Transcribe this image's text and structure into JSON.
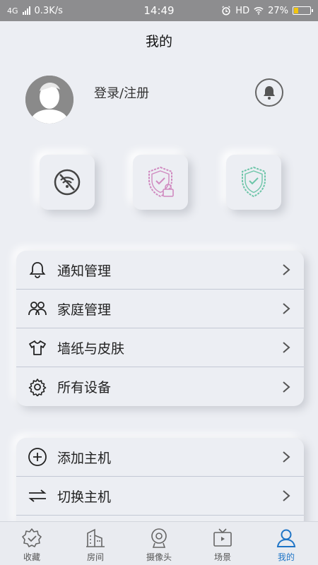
{
  "status_bar": {
    "network": "4G",
    "speed": "0.3K/s",
    "time": "14:49",
    "hd": "HD",
    "battery_percent": "27%",
    "battery_level": 0.27
  },
  "header": {
    "title": "我的"
  },
  "profile": {
    "login_label": "登录/注册"
  },
  "quick_actions": [
    {
      "icon": "wifi-off-icon"
    },
    {
      "icon": "shield-lock-icon",
      "color": "#d08ac0"
    },
    {
      "icon": "shield-check-icon",
      "color": "#6cc5a8"
    }
  ],
  "menu_primary": [
    {
      "label": "通知管理",
      "icon": "bell-outline-icon"
    },
    {
      "label": "家庭管理",
      "icon": "family-icon"
    },
    {
      "label": "墙纸与皮肤",
      "icon": "tshirt-icon"
    },
    {
      "label": "所有设备",
      "icon": "gear-icon"
    }
  ],
  "menu_secondary": [
    {
      "label": "添加主机",
      "icon": "plus-circle-icon"
    },
    {
      "label": "切换主机",
      "icon": "switch-arrows-icon"
    }
  ],
  "tabs": [
    {
      "label": "收藏",
      "icon": "favorite-icon"
    },
    {
      "label": "房间",
      "icon": "building-icon"
    },
    {
      "label": "摄像头",
      "icon": "camera-icon"
    },
    {
      "label": "场景",
      "icon": "tv-icon"
    },
    {
      "label": "我的",
      "icon": "user-icon",
      "active": true
    }
  ],
  "colors": {
    "accent": "#1e74c6",
    "background": "#eceef3",
    "status_bar": "#8d8d8f"
  }
}
